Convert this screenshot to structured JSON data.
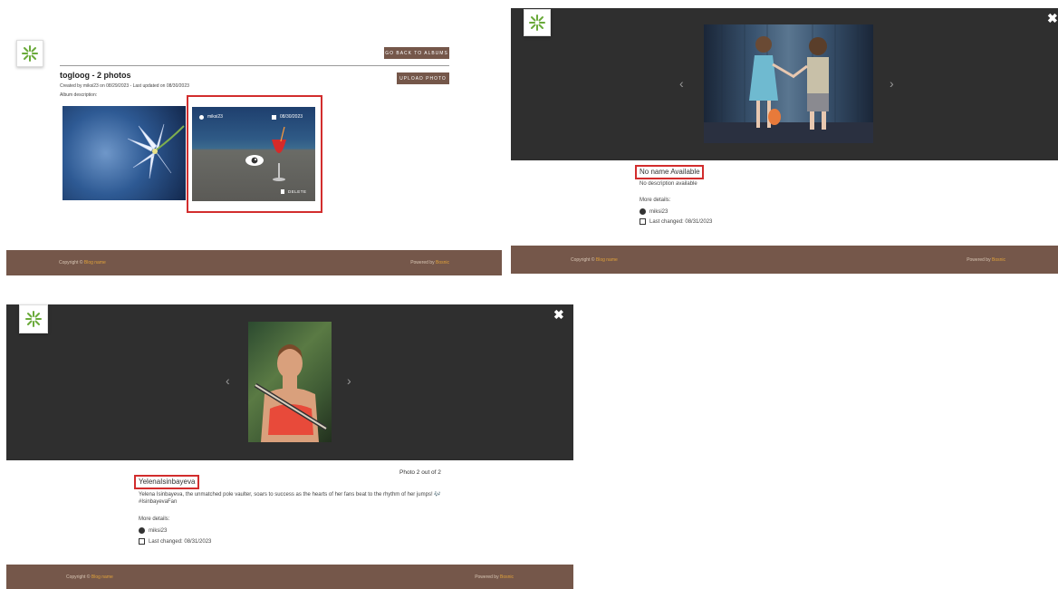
{
  "panel1": {
    "back_button": "GO BACK TO ALBUMS",
    "upload_button": "UPLOAD PHOTO",
    "album_title": "togloog - 2 photos",
    "album_meta": "Created by miksi23 on 08/29/2023 - Last updated on 08/30/2023",
    "album_description": "Album description:",
    "photo2": {
      "user": "miksi23",
      "date": "08/30/2023",
      "delete_label": "DELETE"
    },
    "footer": {
      "copyright": "Copyright ©",
      "brand": "Blog name",
      "powered": "Powered by",
      "powered_brand": "Bosnic"
    }
  },
  "panel2": {
    "title": "No name Available",
    "description": "No description available",
    "more_details": "More details:",
    "user": "miksi23",
    "last_changed": "Last changed: 08/31/2023",
    "footer": {
      "copyright": "Copyright ©",
      "brand": "Blog name",
      "powered": "Powered by",
      "powered_brand": "Bosnic"
    }
  },
  "panel3": {
    "counter": "Photo 2 out of 2",
    "title": "YelenaIsinbayeva",
    "description": "Yelena Isinbayeva, the unmatched pole vaulter, soars to success as the hearts of her fans beat to the rhythm of her jumps! 🎶 #IsinbayevaFan",
    "more_details": "More details:",
    "user": "miksi23",
    "last_changed": "Last changed: 08/31/2023",
    "footer": {
      "copyright": "Copyright ©",
      "brand": "Blog name",
      "powered": "Powered by",
      "powered_brand": "Bosnic"
    }
  },
  "icons": {
    "logo": "green-pinwheel-logo",
    "user": "user-circle-icon",
    "calendar": "calendar-icon",
    "eye": "eye-icon",
    "trash": "trash-icon",
    "close": "close-icon",
    "prev": "chevron-left-icon",
    "next": "chevron-right-icon"
  },
  "colors": {
    "footer": "#75574a",
    "button": "#75574a",
    "dark_overlay": "#2f2f2f",
    "highlight_red": "#d22d2d",
    "logo_green": "#6aaa3a"
  }
}
